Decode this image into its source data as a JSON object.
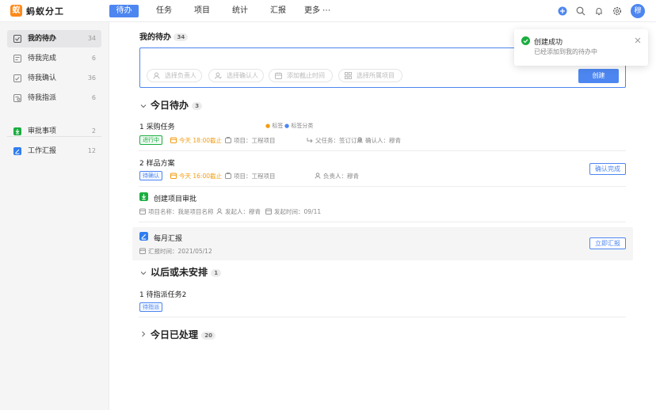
{
  "app": {
    "name": "蚂蚁分工",
    "logo_char": "蚁"
  },
  "nav": {
    "items": [
      "待办",
      "任务",
      "项目",
      "统计",
      "汇报"
    ],
    "more": "更多 ⋯",
    "active": "待办"
  },
  "user": {
    "avatar": "穆"
  },
  "sidebar": {
    "items": [
      {
        "label": "我的待办",
        "count": "34"
      },
      {
        "label": "待我完成",
        "count": "6"
      },
      {
        "label": "待我确认",
        "count": "36"
      },
      {
        "label": "待我指派",
        "count": "6"
      },
      {
        "label": "审批事项",
        "count": "2"
      },
      {
        "label": "工作汇报",
        "count": "12"
      }
    ]
  },
  "header": {
    "title": "我的待办",
    "count": "34"
  },
  "create": {
    "pills": [
      "选择负责人",
      "选择确认人",
      "添加截止时间",
      "选择所属项目"
    ],
    "button": "创建"
  },
  "toast": {
    "title": "创建成功",
    "message": "已经添加到我的待办中"
  },
  "sections": {
    "today": {
      "title": "今日待办",
      "count": "3"
    },
    "later": {
      "title": "以后或未安排",
      "count": "1"
    },
    "done": {
      "title": "今日已处理",
      "count": "20"
    }
  },
  "tasks": {
    "t1": {
      "title": "1 采购任务",
      "label1": "标签",
      "label2": "标签分类",
      "status": "进行中",
      "deadline": "今天 18:00截止",
      "project": "项目：工程项目",
      "parent": "父任务：签订订单",
      "confirmer": "确认人：穆青"
    },
    "t2": {
      "title": "2 样品方案",
      "status": "待确认",
      "deadline": "今天 16:00截止",
      "project": "项目：工程项目",
      "owner": "负责人：穆青",
      "button": "确认完成"
    },
    "t3": {
      "title": "创建项目审批",
      "project": "项目名称：我是项目名称",
      "initiator": "发起人：穆青",
      "time": "发起时间：09/11"
    },
    "t4": {
      "title": "每月汇报",
      "time": "汇报时间：2021/05/12",
      "button": "立即汇报"
    },
    "t5": {
      "title": "1 待指派任务2",
      "status": "待指派"
    }
  },
  "colors": {
    "primary": "#4d86f0",
    "green": "#1aad3f",
    "orange": "#f39c12",
    "logo": "#ff8a1a"
  }
}
